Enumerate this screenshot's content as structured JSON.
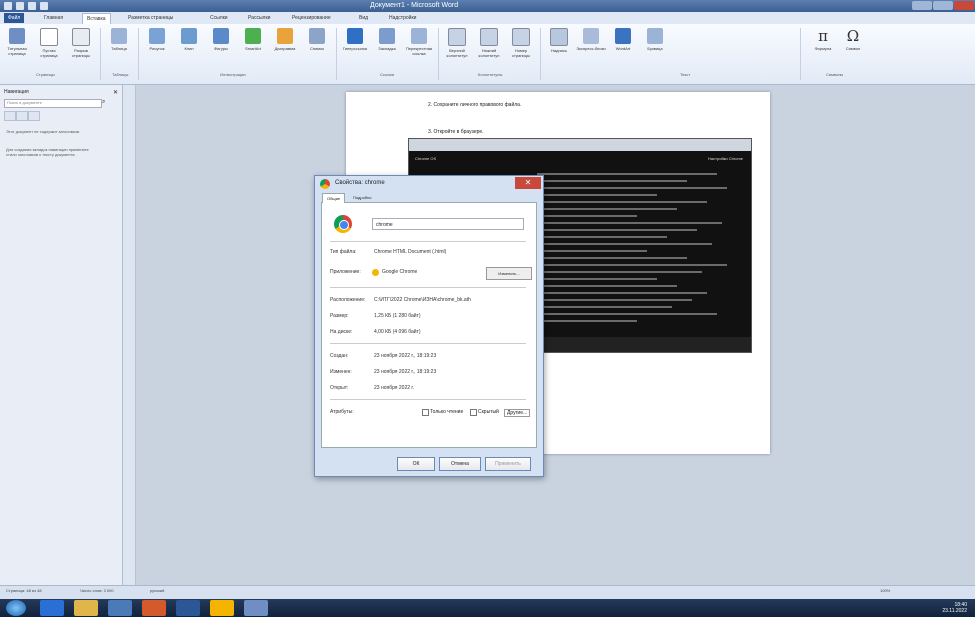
{
  "window": {
    "title": "Документ1 - Microsoft Word"
  },
  "ribbon": {
    "tabs": [
      "Файл",
      "Главная",
      "Вставка",
      "Разметка страницы",
      "Ссылки",
      "Рассылки",
      "Рецензирование",
      "Вид",
      "Надстройки"
    ],
    "buttons": [
      "Титульная страница",
      "Пустая страница",
      "Разрыв страницы",
      "Таблица",
      "Рисунок",
      "Клип",
      "Фигуры",
      "SmartArt",
      "Диаграмма",
      "Снимок",
      "Гиперссылка",
      "Закладка",
      "Перекрестная ссылка",
      "Верхний колонтитул",
      "Нижний колонтитул",
      "Номер страницы",
      "Надпись",
      "Экспресс-блоки",
      "WordArt",
      "Буквица",
      "Формула",
      "Символ"
    ],
    "groups": [
      "Страницы",
      "Таблицы",
      "Иллюстрации",
      "Ссылки",
      "Колонтитулы",
      "Текст",
      "Символы"
    ]
  },
  "nav": {
    "title": "Навигация",
    "search_placeholder": "Поиск в документе",
    "hint1": "Этот документ не содержит заголовков.",
    "hint2": "Для создания вкладок навигации примените стили заголовков к тексту документа."
  },
  "document": {
    "line1": "2. Сохраните личного правового файла.",
    "line2": "3. Откройте в браузере.",
    "shot_left": "Chrome OS",
    "shot_right": "Настройки Chrome"
  },
  "dialog": {
    "title": "Свойства: chrome",
    "tabs": [
      "Общие",
      "Подробно"
    ],
    "name": "chrome",
    "rows1": [
      {
        "label": "Тип файла:",
        "value": "Chrome HTML Document (.html)"
      }
    ],
    "program_label": "Приложение:",
    "program_value": "Google Chrome",
    "change_label": "Изменить...",
    "rows2": [
      {
        "label": "Расположение:",
        "value": "C:\\ИТГ\\2022 Chrome\\ИЗНА\\chrome_bk.ath"
      },
      {
        "label": "Размер:",
        "value": "1,25 КБ (1 280 байт)"
      },
      {
        "label": "На диске:",
        "value": "4,00 КБ (4 096 байт)"
      }
    ],
    "rows3": [
      {
        "label": "Создан:",
        "value": "23 ноября 2022 г., 18:19:23"
      },
      {
        "label": "Изменен:",
        "value": "23 ноября 2022 г., 18:19:23"
      },
      {
        "label": "Открыт:",
        "value": "23 ноября 2022 г."
      }
    ],
    "attr_label": "Атрибуты:",
    "attr_readonly": "Только чтение",
    "attr_hidden": "Скрытый",
    "attr_other": "Другие...",
    "ok": "ОК",
    "cancel": "Отмена",
    "apply": "Применить"
  },
  "status": {
    "page": "Страница: 48 из 48",
    "words": "Число слов: 3 000",
    "lang": "русский",
    "zoom": "100%"
  },
  "clock": {
    "time": "18:40",
    "date": "23.11.2022"
  }
}
